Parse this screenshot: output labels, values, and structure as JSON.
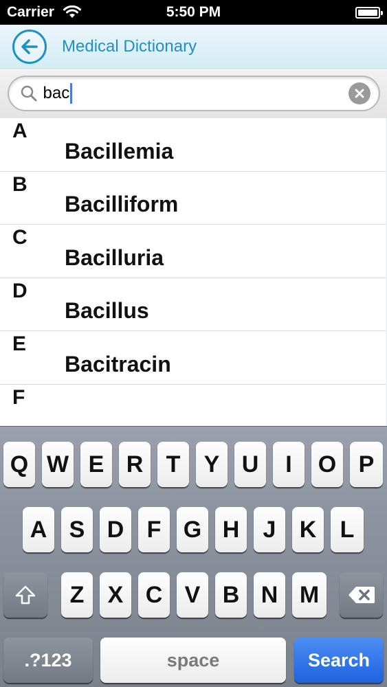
{
  "status_bar": {
    "carrier": "Carrier",
    "time": "5:50 PM"
  },
  "nav": {
    "title": "Medical Dictionary",
    "back_icon": "back-arrow-icon",
    "accent": "#1f8fc4"
  },
  "search": {
    "value": "bac",
    "clear_icon": "clear-icon"
  },
  "index": [
    "A",
    "B",
    "C",
    "D",
    "E",
    "F"
  ],
  "results": [
    "Bacillemia",
    "Bacilliform",
    "Bacilluria",
    "Bacillus",
    "Bacitracin"
  ],
  "keyboard": {
    "row1": [
      "Q",
      "W",
      "E",
      "R",
      "T",
      "Y",
      "U",
      "I",
      "O",
      "P"
    ],
    "row2": [
      "A",
      "S",
      "D",
      "F",
      "G",
      "H",
      "J",
      "K",
      "L"
    ],
    "row3": [
      "Z",
      "X",
      "C",
      "V",
      "B",
      "N",
      "M"
    ],
    "shift_icon": "shift-icon",
    "delete_icon": "delete-icon",
    "numbers_label": ".?123",
    "space_label": "space",
    "search_label": "Search",
    "search_key_color": "#1d62e0"
  }
}
